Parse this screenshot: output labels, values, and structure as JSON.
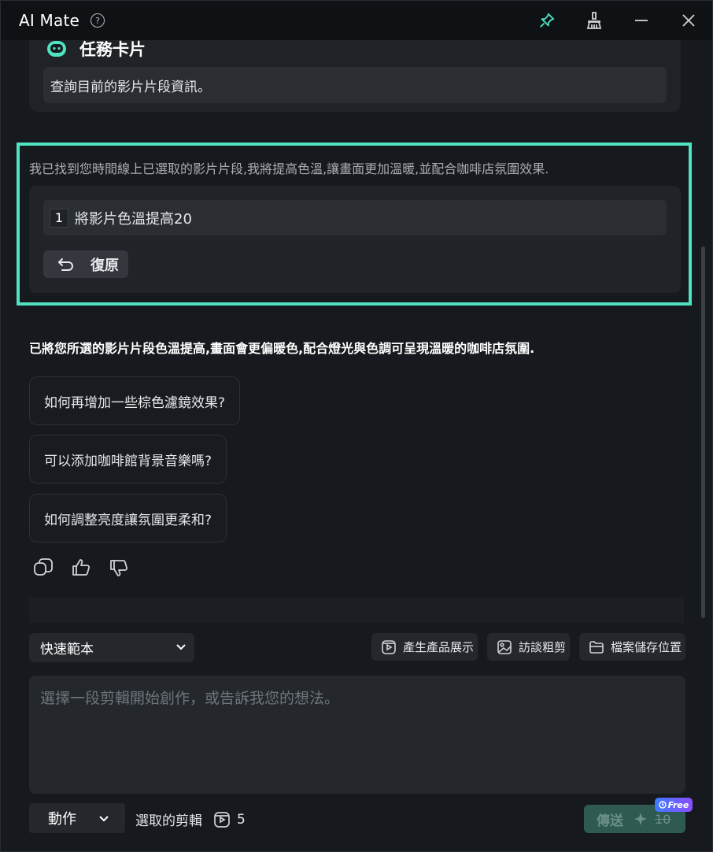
{
  "window": {
    "title": "AI Mate",
    "help_icon": "question-circle-icon",
    "buttons": [
      "pin-icon",
      "broom-clean-icon",
      "minimize-icon",
      "close-icon"
    ],
    "accent_color": "#4fe3c1"
  },
  "task_card": {
    "title": "任務卡片",
    "description": "查詢目前的影片片段資訊。"
  },
  "assistant_reply": {
    "text": "我已找到您時間線上已選取的影片片段,我將提高色溫,讓畫面更加溫暖,並配合咖啡店氛圍效果.",
    "steps": [
      {
        "num": "1",
        "text": "將影片色溫提高20"
      }
    ],
    "undo_label": "復原"
  },
  "summary": "已將您所選的影片片段色溫提高,畫面會更偏暖色,配合燈光與色調可呈現溫暖的咖啡店氛圍.",
  "suggestions": [
    "如何再增加一些棕色濾鏡效果?",
    "可以添加咖啡館背景音樂嗎?",
    "如何調整亮度讓氛圍更柔和?"
  ],
  "feedback_icons": [
    "copy-icon",
    "thumbs-up-icon",
    "thumbs-down-icon"
  ],
  "composer": {
    "template_label": "快速範本",
    "chips": [
      "產生產品展示",
      "訪談粗剪",
      "檔案儲存位置"
    ],
    "placeholder": "選擇一段剪輯開始創作，或告訴我您的想法。",
    "action_label": "動作",
    "selected_clips_label": "選取的剪輯",
    "selected_clips_count": "5",
    "send_label": "傳送",
    "send_cost": "10",
    "free_badge": "Free"
  }
}
